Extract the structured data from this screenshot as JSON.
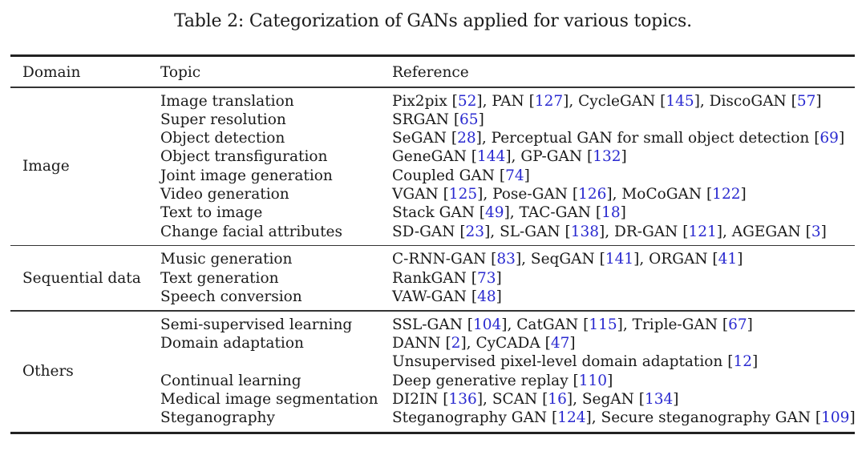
{
  "caption": "Table 2: Categorization of GANs applied for various topics.",
  "headers": {
    "domain": "Domain",
    "topic": "Topic",
    "reference": "Reference"
  },
  "colors": {
    "citation": "#2a2ad0",
    "text": "#1a1a1a"
  },
  "groups": [
    {
      "domain": "Image",
      "rows": [
        {
          "topic": "Image translation",
          "refs": [
            [
              "Pix2pix",
              "52"
            ],
            [
              "PAN",
              "127"
            ],
            [
              "CycleGAN",
              "145"
            ],
            [
              "DiscoGAN",
              "57"
            ]
          ]
        },
        {
          "topic": "Super resolution",
          "refs": [
            [
              "SRGAN",
              "65"
            ]
          ]
        },
        {
          "topic": "Object detection",
          "refs": [
            [
              "SeGAN",
              "28"
            ],
            [
              "Perceptual GAN for small object detection",
              "69"
            ]
          ]
        },
        {
          "topic": "Object transfiguration",
          "refs": [
            [
              "GeneGAN",
              "144"
            ],
            [
              "GP-GAN",
              "132"
            ]
          ]
        },
        {
          "topic": "Joint image generation",
          "refs": [
            [
              "Coupled GAN",
              "74"
            ]
          ]
        },
        {
          "topic": "Video generation",
          "refs": [
            [
              "VGAN",
              "125"
            ],
            [
              "Pose-GAN",
              "126"
            ],
            [
              "MoCoGAN",
              "122"
            ]
          ]
        },
        {
          "topic": "Text to image",
          "refs": [
            [
              "Stack GAN",
              "49"
            ],
            [
              "TAC-GAN",
              "18"
            ]
          ]
        },
        {
          "topic": "Change facial attributes",
          "refs": [
            [
              "SD-GAN",
              "23"
            ],
            [
              "SL-GAN",
              "138"
            ],
            [
              "DR-GAN",
              "121"
            ],
            [
              "AGEGAN",
              "3"
            ]
          ]
        }
      ]
    },
    {
      "domain": "Sequential data",
      "rows": [
        {
          "topic": "Music generation",
          "refs": [
            [
              "C-RNN-GAN",
              "83"
            ],
            [
              "SeqGAN",
              "141"
            ],
            [
              "ORGAN",
              "41"
            ]
          ]
        },
        {
          "topic": "Text generation",
          "refs": [
            [
              "RankGAN",
              "73"
            ]
          ]
        },
        {
          "topic": "Speech conversion",
          "refs": [
            [
              "VAW-GAN",
              "48"
            ]
          ]
        }
      ]
    },
    {
      "domain": "Others",
      "rows": [
        {
          "topic": "Semi-supervised learning",
          "refs": [
            [
              "SSL-GAN",
              "104"
            ],
            [
              "CatGAN",
              "115"
            ],
            [
              "Triple-GAN",
              "67"
            ]
          ]
        },
        {
          "topic": "Domain adaptation",
          "refs": [
            [
              "DANN",
              "2"
            ],
            [
              "CyCADA",
              "47"
            ]
          ]
        },
        {
          "topic": "",
          "refs": [
            [
              "Unsupervised pixel-level domain adaptation",
              "12"
            ]
          ]
        },
        {
          "topic": "Continual learning",
          "refs": [
            [
              "Deep generative replay",
              "110"
            ]
          ]
        },
        {
          "topic": "Medical image segmentation",
          "refs": [
            [
              "DI2IN",
              "136"
            ],
            [
              "SCAN",
              "16"
            ],
            [
              "SegAN",
              "134"
            ]
          ]
        },
        {
          "topic": "Steganography",
          "refs": [
            [
              "Steganography GAN",
              "124"
            ],
            [
              "Secure steganography GAN",
              "109"
            ]
          ]
        }
      ]
    }
  ]
}
